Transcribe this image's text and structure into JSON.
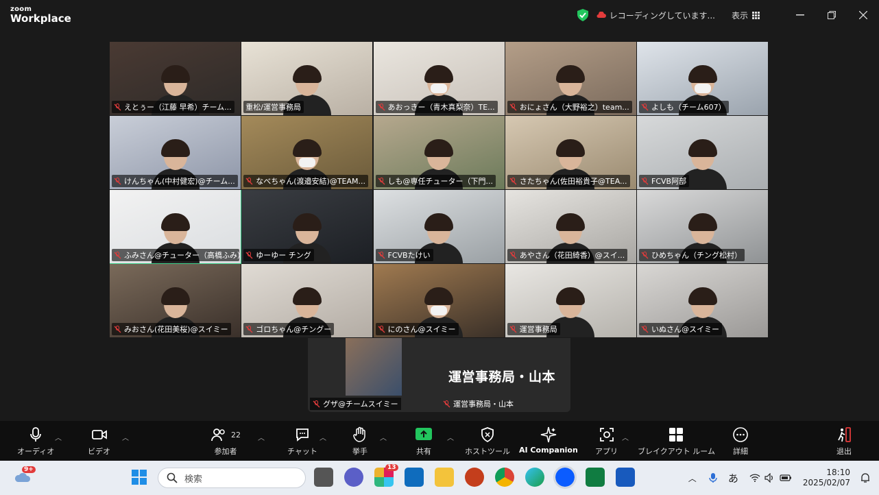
{
  "app": {
    "brand_small": "zoom",
    "brand_large": "Workplace"
  },
  "titlebar": {
    "recording": "レコーディングしています...",
    "view": "表示"
  },
  "tiles": [
    {
      "name": "えとぅー（江藤 早希）チーム..."
    },
    {
      "name": "重松/運営事務局"
    },
    {
      "name": "あおっきー（青木真梨奈）TE..."
    },
    {
      "name": "おにょさん（大野裕之）team..."
    },
    {
      "name": "よしも（チーム607）"
    },
    {
      "name": "けんちゃん(中村健宏)@チーム..."
    },
    {
      "name": "なべちゃん(渡邉安結)@TEAM..."
    },
    {
      "name": "しも@専任チューター（下門..."
    },
    {
      "name": "さたちゃん(佐田裕貴子@TEA..."
    },
    {
      "name": "FCVB阿部"
    },
    {
      "name": "ふみさん@チューター（高橋ふみ）"
    },
    {
      "name": "ゆーゆー チング"
    },
    {
      "name": "FCVBたけい"
    },
    {
      "name": "あやさん（花田綺香）@スイ..."
    },
    {
      "name": "ひめちゃん（チング松村）"
    },
    {
      "name": "みおさん(花田美桜)@スイミー"
    },
    {
      "name": "ゴロちゃん@チングー"
    },
    {
      "name": "にのさん@スイミー"
    },
    {
      "name": "運営事務局"
    },
    {
      "name": "いぬさん@スイミー"
    }
  ],
  "strip": {
    "thumb_name": "グザ@チームスイミー",
    "speaker_big": "運営事務局・山本",
    "speaker_label": "運営事務局・山本"
  },
  "toolbar": {
    "audio": "オーディオ",
    "video": "ビデオ",
    "participants": "参加者",
    "participants_count": "22",
    "chat": "チャット",
    "raise": "挙手",
    "share": "共有",
    "host": "ホストツール",
    "ai": "AI Companion",
    "apps": "アプリ",
    "breakout": "ブレイクアウト ルーム",
    "more": "詳細",
    "leave": "退出"
  },
  "taskbar": {
    "search_placeholder": "検索",
    "weather_badge": "9+",
    "slack_badge": "13",
    "ime": "あ",
    "time": "18:10",
    "date": "2025/02/07"
  },
  "colors": {
    "active_speaker": "#3cd38c",
    "share_green": "#22c55e",
    "mic_off": "#e23b3b"
  }
}
